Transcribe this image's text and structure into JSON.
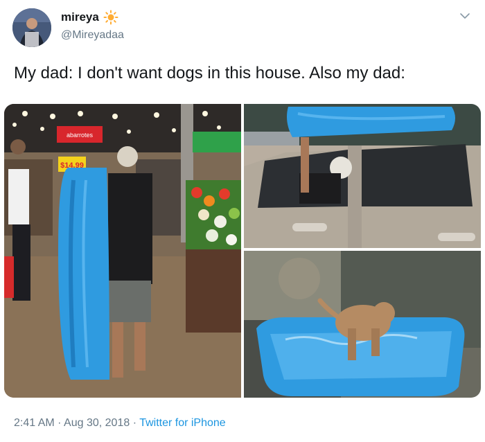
{
  "author": {
    "display_name": "mireya",
    "handle": "@Mireyadaa",
    "badge_icon": "sun-icon"
  },
  "tweet": {
    "text": "My dad: I don't want dogs in this house. Also my dad:"
  },
  "media": {
    "store_sign": "abarrotes",
    "price_tag": "$14.99"
  },
  "meta": {
    "time": "2:41 AM",
    "separator1": " · ",
    "date": "Aug 30, 2018",
    "separator2": " · ",
    "source": "Twitter for iPhone"
  },
  "colors": {
    "text": "#14171a",
    "secondary": "#657786",
    "link": "#1b95e0",
    "pool": "#2f9be0"
  }
}
